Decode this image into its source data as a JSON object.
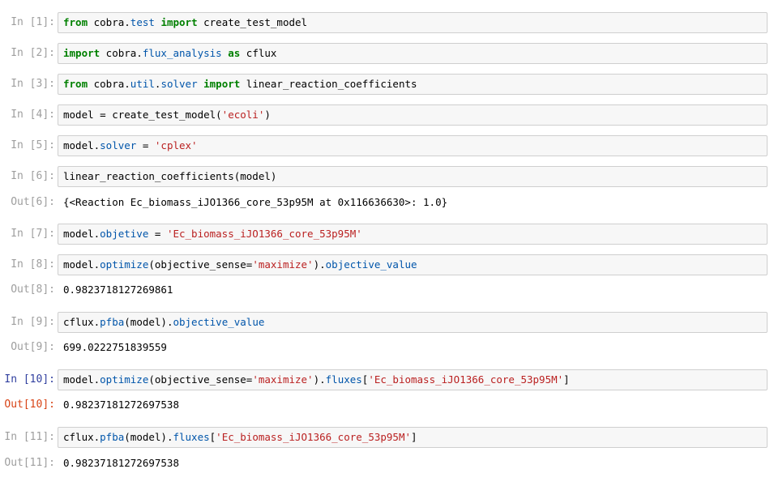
{
  "cells": [
    {
      "in_prompt": "In [1]:",
      "tokens": [
        {
          "t": "from",
          "c": "kw"
        },
        {
          "t": " cobra."
        },
        {
          "t": "test",
          "c": "at"
        },
        {
          "t": " "
        },
        {
          "t": "import",
          "c": "kw"
        },
        {
          "t": " create_test_model"
        }
      ]
    },
    {
      "in_prompt": "In [2]:",
      "tokens": [
        {
          "t": "import",
          "c": "kw"
        },
        {
          "t": " cobra."
        },
        {
          "t": "flux_analysis",
          "c": "at"
        },
        {
          "t": " "
        },
        {
          "t": "as",
          "c": "kw"
        },
        {
          "t": " cflux"
        }
      ]
    },
    {
      "in_prompt": "In [3]:",
      "tokens": [
        {
          "t": "from",
          "c": "kw"
        },
        {
          "t": " cobra."
        },
        {
          "t": "util",
          "c": "at"
        },
        {
          "t": "."
        },
        {
          "t": "solver",
          "c": "at"
        },
        {
          "t": " "
        },
        {
          "t": "import",
          "c": "kw"
        },
        {
          "t": " linear_reaction_coefficients"
        }
      ]
    },
    {
      "in_prompt": "In [4]:",
      "tokens": [
        {
          "t": "model = create_test_model("
        },
        {
          "t": "'ecoli'",
          "c": "st"
        },
        {
          "t": ")"
        }
      ]
    },
    {
      "in_prompt": "In [5]:",
      "tokens": [
        {
          "t": "model."
        },
        {
          "t": "solver",
          "c": "at"
        },
        {
          "t": " = "
        },
        {
          "t": "'cplex'",
          "c": "st"
        }
      ]
    },
    {
      "in_prompt": "In [6]:",
      "tokens": [
        {
          "t": "linear_reaction_coefficients(model)"
        }
      ],
      "out_prompt": "Out[6]:",
      "output": "{<Reaction Ec_biomass_iJO1366_core_53p95M at 0x116636630>: 1.0}"
    },
    {
      "in_prompt": "In [7]:",
      "tokens": [
        {
          "t": "model."
        },
        {
          "t": "objetive",
          "c": "at"
        },
        {
          "t": " = "
        },
        {
          "t": "'Ec_biomass_iJO1366_core_53p95M'",
          "c": "st"
        }
      ]
    },
    {
      "in_prompt": "In [8]:",
      "tokens": [
        {
          "t": "model."
        },
        {
          "t": "optimize",
          "c": "at"
        },
        {
          "t": "(objective_sense="
        },
        {
          "t": "'maximize'",
          "c": "st"
        },
        {
          "t": ")."
        },
        {
          "t": "objective_value",
          "c": "at"
        }
      ],
      "out_prompt": "Out[8]:",
      "output": "0.9823718127269861"
    },
    {
      "in_prompt": "In [9]:",
      "tokens": [
        {
          "t": "cflux."
        },
        {
          "t": "pfba",
          "c": "at"
        },
        {
          "t": "(model)."
        },
        {
          "t": "objective_value",
          "c": "at"
        }
      ],
      "out_prompt": "Out[9]:",
      "output": "699.0222751839559"
    },
    {
      "in_prompt": "In [10]:",
      "active": true,
      "tokens": [
        {
          "t": "model."
        },
        {
          "t": "optimize",
          "c": "at"
        },
        {
          "t": "(objective_sense="
        },
        {
          "t": "'maximize'",
          "c": "st"
        },
        {
          "t": ")."
        },
        {
          "t": "fluxes",
          "c": "at"
        },
        {
          "t": "["
        },
        {
          "t": "'Ec_biomass_iJO1366_core_53p95M'",
          "c": "st"
        },
        {
          "t": "]"
        }
      ],
      "out_prompt": "Out[10]:",
      "output": "0.98237181272697538"
    },
    {
      "in_prompt": "In [11]:",
      "tokens": [
        {
          "t": "cflux."
        },
        {
          "t": "pfba",
          "c": "at"
        },
        {
          "t": "(model)."
        },
        {
          "t": "fluxes",
          "c": "at"
        },
        {
          "t": "["
        },
        {
          "t": "'Ec_biomass_iJO1366_core_53p95M'",
          "c": "st"
        },
        {
          "t": "]"
        }
      ],
      "out_prompt": "Out[11]:",
      "output": "0.98237181272697538"
    }
  ]
}
